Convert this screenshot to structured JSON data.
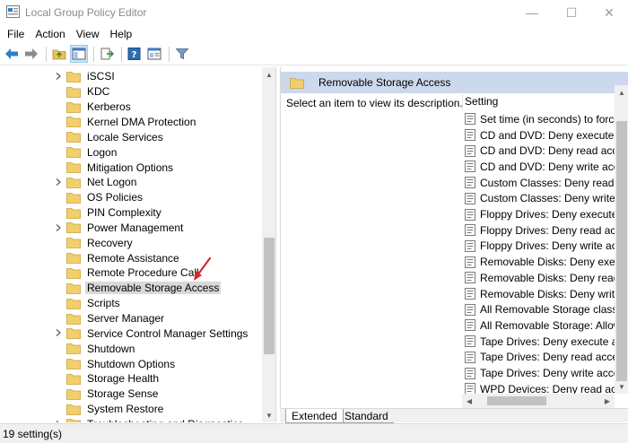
{
  "window": {
    "title": "Local Group Policy Editor",
    "min_glyph": "—",
    "max_glyph": "☐",
    "close_glyph": "✕"
  },
  "menu": [
    "File",
    "Action",
    "View",
    "Help"
  ],
  "toolbar": {
    "icons": [
      "back-arrow-icon",
      "forward-arrow-icon",
      "up-folder-icon",
      "show-hide-tree-icon",
      "export-list-icon",
      "help-icon",
      "properties-icon",
      "filter-icon"
    ]
  },
  "tree": {
    "items": [
      {
        "label": "iSCSI",
        "expandable": true
      },
      {
        "label": "KDC",
        "expandable": false
      },
      {
        "label": "Kerberos",
        "expandable": false
      },
      {
        "label": "Kernel DMA Protection",
        "expandable": false
      },
      {
        "label": "Locale Services",
        "expandable": false
      },
      {
        "label": "Logon",
        "expandable": false
      },
      {
        "label": "Mitigation Options",
        "expandable": false
      },
      {
        "label": "Net Logon",
        "expandable": true
      },
      {
        "label": "OS Policies",
        "expandable": false
      },
      {
        "label": "PIN Complexity",
        "expandable": false
      },
      {
        "label": "Power Management",
        "expandable": true
      },
      {
        "label": "Recovery",
        "expandable": false
      },
      {
        "label": "Remote Assistance",
        "expandable": false
      },
      {
        "label": "Remote Procedure Call",
        "expandable": false
      },
      {
        "label": "Removable Storage Access",
        "expandable": false,
        "selected": true
      },
      {
        "label": "Scripts",
        "expandable": false
      },
      {
        "label": "Server Manager",
        "expandable": false
      },
      {
        "label": "Service Control Manager Settings",
        "expandable": true
      },
      {
        "label": "Shutdown",
        "expandable": false
      },
      {
        "label": "Shutdown Options",
        "expandable": false
      },
      {
        "label": "Storage Health",
        "expandable": false
      },
      {
        "label": "Storage Sense",
        "expandable": false
      },
      {
        "label": "System Restore",
        "expandable": false
      },
      {
        "label": "Troubleshooting and Diagnostics",
        "expandable": true
      }
    ]
  },
  "right": {
    "header": "Removable Storage Access",
    "description": "Select an item to view its description.",
    "column_header": "Setting",
    "settings": [
      "Set time (in seconds) to force r",
      "CD and DVD: Deny execute acc",
      "CD and DVD: Deny read access",
      "CD and DVD: Deny write access",
      "Custom Classes: Deny read acc",
      "Custom Classes: Deny write acc",
      "Floppy Drives: Deny execute ac",
      "Floppy Drives: Deny read acces",
      "Floppy Drives: Deny write acces",
      "Removable Disks: Deny execute",
      "Removable Disks: Deny read acc",
      "Removable Disks: Deny write ac",
      "All Removable Storage classes:",
      "All Removable Storage: Allow c",
      "Tape Drives: Deny execute acce",
      "Tape Drives: Deny read access",
      "Tape Drives: Deny write access",
      "WPD Devices: Deny read access"
    ]
  },
  "tabs": [
    "Extended",
    "Standard"
  ],
  "status": "19 setting(s)",
  "colors": {
    "folder": "#f2cf6b",
    "header_bg": "#ccd9ec",
    "annotation": "#d42a2a"
  }
}
